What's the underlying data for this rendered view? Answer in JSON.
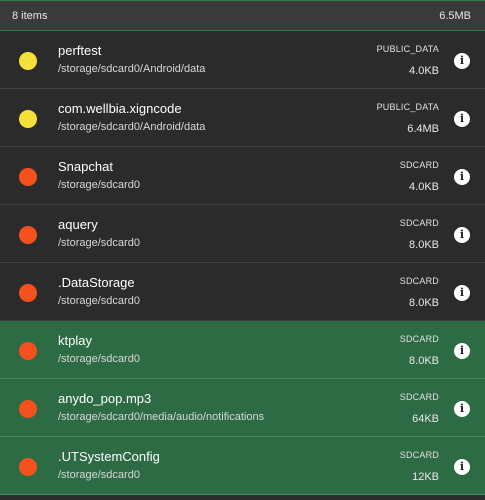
{
  "header": {
    "count_label": "8 items",
    "total_size": "6.5MB"
  },
  "colors": {
    "public_data_dot": "#f5e03a",
    "sdcard_dot": "#f4511e",
    "selected_row": "#2d6b44",
    "row_bg": "#2b2b2b"
  },
  "items": [
    {
      "name": "perftest",
      "path": "/storage/sdcard0/Android/data",
      "location": "PUBLIC_DATA",
      "size": "4.0KB",
      "dot_color": "#f5e03a",
      "selected": false,
      "icon": "info-icon"
    },
    {
      "name": "com.wellbia.xigncode",
      "path": "/storage/sdcard0/Android/data",
      "location": "PUBLIC_DATA",
      "size": "6.4MB",
      "dot_color": "#f5e03a",
      "selected": false,
      "icon": "info-icon"
    },
    {
      "name": "Snapchat",
      "path": "/storage/sdcard0",
      "location": "SDCARD",
      "size": "4.0KB",
      "dot_color": "#f4511e",
      "selected": false,
      "icon": "info-icon"
    },
    {
      "name": "aquery",
      "path": "/storage/sdcard0",
      "location": "SDCARD",
      "size": "8.0KB",
      "dot_color": "#f4511e",
      "selected": false,
      "icon": "info-icon"
    },
    {
      "name": ".DataStorage",
      "path": "/storage/sdcard0",
      "location": "SDCARD",
      "size": "8.0KB",
      "dot_color": "#f4511e",
      "selected": false,
      "icon": "info-icon"
    },
    {
      "name": "ktplay",
      "path": "/storage/sdcard0",
      "location": "SDCARD",
      "size": "8.0KB",
      "dot_color": "#f4511e",
      "selected": true,
      "icon": "info-icon"
    },
    {
      "name": "anydo_pop.mp3",
      "path": "/storage/sdcard0/media/audio/notifications",
      "location": "SDCARD",
      "size": "64KB",
      "dot_color": "#f4511e",
      "selected": true,
      "icon": "info-icon"
    },
    {
      "name": ".UTSystemConfig",
      "path": "/storage/sdcard0",
      "location": "SDCARD",
      "size": "12KB",
      "dot_color": "#f4511e",
      "selected": true,
      "icon": "info-icon"
    }
  ]
}
